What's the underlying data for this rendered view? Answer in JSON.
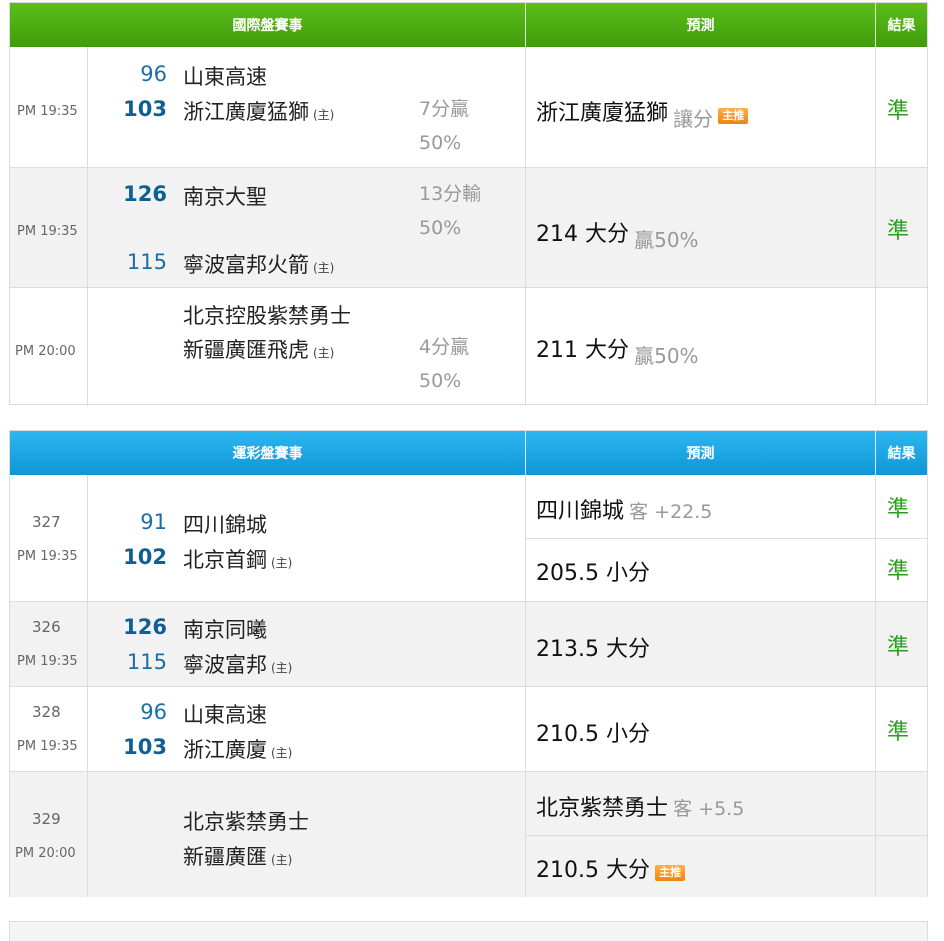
{
  "intl": {
    "header": {
      "game": "國際盤賽事",
      "pred": "預測",
      "result": "結果"
    },
    "rows": [
      {
        "time": "PM 19:35",
        "score_away": "96",
        "score_home": "103",
        "team_away": "山東高速",
        "team_home": "浙江廣廈猛獅",
        "host_mark": "(主)",
        "spread_line1": "7分贏",
        "spread_line2": "50%",
        "pred_main": "浙江廣廈猛獅",
        "pred_sub": "讓分",
        "badge": "主推",
        "result": "準"
      },
      {
        "time": "PM 19:35",
        "score_away": "126",
        "score_home": "115",
        "team_away": "南京大聖",
        "team_home": "寧波富邦火箭",
        "host_mark": "(主)",
        "spread_line1": "13分輸",
        "spread_line2": "50%",
        "pred_main": "214 大分",
        "pred_sub": "贏50%",
        "result": "準"
      },
      {
        "time": "PM 20:00",
        "team_away": "北京控股紫禁勇士",
        "team_home": "新疆廣匯飛虎",
        "host_mark": "(主)",
        "spread_line1": "4分贏",
        "spread_line2": "50%",
        "pred_main": "211 大分",
        "pred_sub": "贏50%",
        "result": ""
      }
    ]
  },
  "lottery": {
    "header": {
      "game": "運彩盤賽事",
      "pred": "預測",
      "result": "結果"
    },
    "rows": [
      {
        "num": "327",
        "time": "PM 19:35",
        "score_away": "91",
        "score_home": "102",
        "team_away": "四川錦城",
        "team_home": "北京首鋼",
        "host_mark": "(主)",
        "pred1_main": "四川錦城",
        "pred1_sub": "客 +22.5",
        "result1": "準",
        "pred2_main": "205.5 小分",
        "result2": "準"
      },
      {
        "num": "326",
        "time": "PM 19:35",
        "score_away": "126",
        "score_home": "115",
        "team_away": "南京同曦",
        "team_home": "寧波富邦",
        "host_mark": "(主)",
        "pred_main": "213.5 大分",
        "result": "準"
      },
      {
        "num": "328",
        "time": "PM 19:35",
        "score_away": "96",
        "score_home": "103",
        "team_away": "山東高速",
        "team_home": "浙江廣廈",
        "host_mark": "(主)",
        "pred_main": "210.5 小分",
        "result": "準"
      },
      {
        "num": "329",
        "time": "PM 20:00",
        "team_away": "北京紫禁勇士",
        "team_home": "新疆廣匯",
        "host_mark": "(主)",
        "pred1_main": "北京紫禁勇士",
        "pred1_sub": "客 +5.5",
        "result1": "",
        "pred2_main": "210.5 大分",
        "badge": "主推",
        "result2": ""
      }
    ]
  }
}
